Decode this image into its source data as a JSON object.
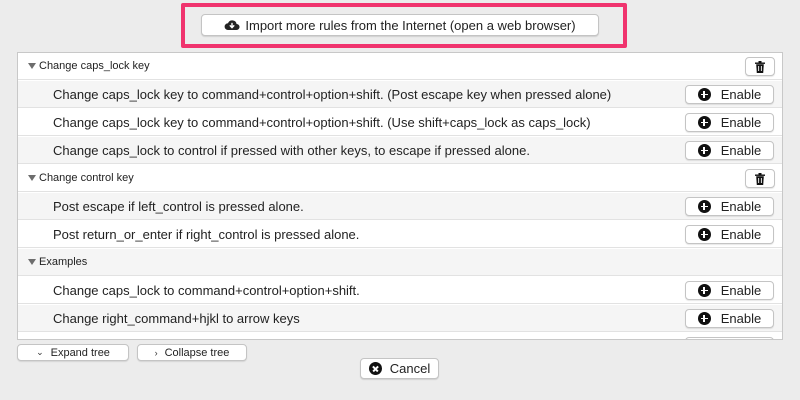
{
  "header": {
    "import_button_label": "Import more rules from the Internet (open a web browser)",
    "import_icon": "cloud-download-icon",
    "highlight_color": "#f0346e"
  },
  "groups": [
    {
      "title": "Change caps_lock key",
      "rules": [
        {
          "text": "Change caps_lock key to command+control+option+shift. (Post escape key when pressed alone)",
          "button": "Enable"
        },
        {
          "text": "Change caps_lock key to command+control+option+shift. (Use shift+caps_lock as caps_lock)",
          "button": "Enable"
        },
        {
          "text": "Change caps_lock to control if pressed with other keys, to escape if pressed alone.",
          "button": "Enable"
        }
      ]
    },
    {
      "title": "Change control key",
      "rules": [
        {
          "text": "Post escape if left_control is pressed alone.",
          "button": "Enable"
        },
        {
          "text": "Post return_or_enter if right_control is pressed alone.",
          "button": "Enable"
        }
      ]
    },
    {
      "title": "Examples",
      "rules": [
        {
          "text": "Change caps_lock to command+control+option+shift.",
          "button": "Enable"
        },
        {
          "text": "Change right_command+hjkl to arrow keys",
          "button": "Enable"
        }
      ]
    }
  ],
  "footer": {
    "expand_label": "Expand tree",
    "collapse_label": "Collapse tree",
    "cancel_label": "Cancel"
  }
}
